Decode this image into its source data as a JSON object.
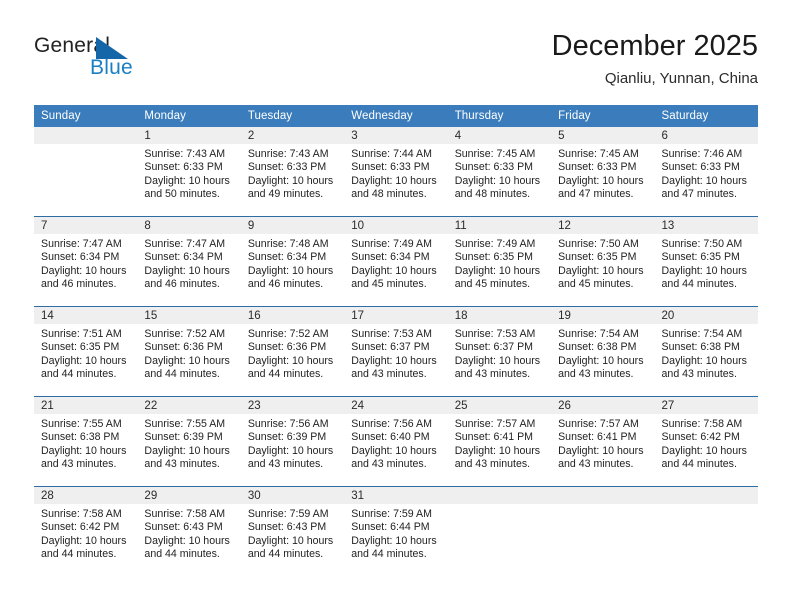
{
  "brand": {
    "name_primary": "General",
    "name_secondary": "Blue",
    "triangle_color": "#1566a8",
    "secondary_color": "#1b7fc4"
  },
  "header": {
    "title": "December 2025",
    "location": "Qianliu, Yunnan, China"
  },
  "theme": {
    "header_bg": "#3b7dbc",
    "header_text": "#ffffff",
    "date_band_bg": "#efefef",
    "row_rule": "#2e6da4",
    "body_text": "#1f1f1f"
  },
  "weekday_headers": [
    "Sunday",
    "Monday",
    "Tuesday",
    "Wednesday",
    "Thursday",
    "Friday",
    "Saturday"
  ],
  "labels": {
    "sunrise_prefix": "Sunrise:",
    "sunset_prefix": "Sunset:",
    "daylight_prefix": "Daylight:"
  },
  "weeks": [
    [
      {
        "day": "",
        "empty": true
      },
      {
        "day": "1",
        "sunrise": "Sunrise: 7:43 AM",
        "sunset": "Sunset: 6:33 PM",
        "daylight_line1": "Daylight: 10 hours",
        "daylight_line2": "and 50 minutes."
      },
      {
        "day": "2",
        "sunrise": "Sunrise: 7:43 AM",
        "sunset": "Sunset: 6:33 PM",
        "daylight_line1": "Daylight: 10 hours",
        "daylight_line2": "and 49 minutes."
      },
      {
        "day": "3",
        "sunrise": "Sunrise: 7:44 AM",
        "sunset": "Sunset: 6:33 PM",
        "daylight_line1": "Daylight: 10 hours",
        "daylight_line2": "and 48 minutes."
      },
      {
        "day": "4",
        "sunrise": "Sunrise: 7:45 AM",
        "sunset": "Sunset: 6:33 PM",
        "daylight_line1": "Daylight: 10 hours",
        "daylight_line2": "and 48 minutes."
      },
      {
        "day": "5",
        "sunrise": "Sunrise: 7:45 AM",
        "sunset": "Sunset: 6:33 PM",
        "daylight_line1": "Daylight: 10 hours",
        "daylight_line2": "and 47 minutes."
      },
      {
        "day": "6",
        "sunrise": "Sunrise: 7:46 AM",
        "sunset": "Sunset: 6:33 PM",
        "daylight_line1": "Daylight: 10 hours",
        "daylight_line2": "and 47 minutes."
      }
    ],
    [
      {
        "day": "7",
        "sunrise": "Sunrise: 7:47 AM",
        "sunset": "Sunset: 6:34 PM",
        "daylight_line1": "Daylight: 10 hours",
        "daylight_line2": "and 46 minutes."
      },
      {
        "day": "8",
        "sunrise": "Sunrise: 7:47 AM",
        "sunset": "Sunset: 6:34 PM",
        "daylight_line1": "Daylight: 10 hours",
        "daylight_line2": "and 46 minutes."
      },
      {
        "day": "9",
        "sunrise": "Sunrise: 7:48 AM",
        "sunset": "Sunset: 6:34 PM",
        "daylight_line1": "Daylight: 10 hours",
        "daylight_line2": "and 46 minutes."
      },
      {
        "day": "10",
        "sunrise": "Sunrise: 7:49 AM",
        "sunset": "Sunset: 6:34 PM",
        "daylight_line1": "Daylight: 10 hours",
        "daylight_line2": "and 45 minutes."
      },
      {
        "day": "11",
        "sunrise": "Sunrise: 7:49 AM",
        "sunset": "Sunset: 6:35 PM",
        "daylight_line1": "Daylight: 10 hours",
        "daylight_line2": "and 45 minutes."
      },
      {
        "day": "12",
        "sunrise": "Sunrise: 7:50 AM",
        "sunset": "Sunset: 6:35 PM",
        "daylight_line1": "Daylight: 10 hours",
        "daylight_line2": "and 45 minutes."
      },
      {
        "day": "13",
        "sunrise": "Sunrise: 7:50 AM",
        "sunset": "Sunset: 6:35 PM",
        "daylight_line1": "Daylight: 10 hours",
        "daylight_line2": "and 44 minutes."
      }
    ],
    [
      {
        "day": "14",
        "sunrise": "Sunrise: 7:51 AM",
        "sunset": "Sunset: 6:35 PM",
        "daylight_line1": "Daylight: 10 hours",
        "daylight_line2": "and 44 minutes."
      },
      {
        "day": "15",
        "sunrise": "Sunrise: 7:52 AM",
        "sunset": "Sunset: 6:36 PM",
        "daylight_line1": "Daylight: 10 hours",
        "daylight_line2": "and 44 minutes."
      },
      {
        "day": "16",
        "sunrise": "Sunrise: 7:52 AM",
        "sunset": "Sunset: 6:36 PM",
        "daylight_line1": "Daylight: 10 hours",
        "daylight_line2": "and 44 minutes."
      },
      {
        "day": "17",
        "sunrise": "Sunrise: 7:53 AM",
        "sunset": "Sunset: 6:37 PM",
        "daylight_line1": "Daylight: 10 hours",
        "daylight_line2": "and 43 minutes."
      },
      {
        "day": "18",
        "sunrise": "Sunrise: 7:53 AM",
        "sunset": "Sunset: 6:37 PM",
        "daylight_line1": "Daylight: 10 hours",
        "daylight_line2": "and 43 minutes."
      },
      {
        "day": "19",
        "sunrise": "Sunrise: 7:54 AM",
        "sunset": "Sunset: 6:38 PM",
        "daylight_line1": "Daylight: 10 hours",
        "daylight_line2": "and 43 minutes."
      },
      {
        "day": "20",
        "sunrise": "Sunrise: 7:54 AM",
        "sunset": "Sunset: 6:38 PM",
        "daylight_line1": "Daylight: 10 hours",
        "daylight_line2": "and 43 minutes."
      }
    ],
    [
      {
        "day": "21",
        "sunrise": "Sunrise: 7:55 AM",
        "sunset": "Sunset: 6:38 PM",
        "daylight_line1": "Daylight: 10 hours",
        "daylight_line2": "and 43 minutes."
      },
      {
        "day": "22",
        "sunrise": "Sunrise: 7:55 AM",
        "sunset": "Sunset: 6:39 PM",
        "daylight_line1": "Daylight: 10 hours",
        "daylight_line2": "and 43 minutes."
      },
      {
        "day": "23",
        "sunrise": "Sunrise: 7:56 AM",
        "sunset": "Sunset: 6:39 PM",
        "daylight_line1": "Daylight: 10 hours",
        "daylight_line2": "and 43 minutes."
      },
      {
        "day": "24",
        "sunrise": "Sunrise: 7:56 AM",
        "sunset": "Sunset: 6:40 PM",
        "daylight_line1": "Daylight: 10 hours",
        "daylight_line2": "and 43 minutes."
      },
      {
        "day": "25",
        "sunrise": "Sunrise: 7:57 AM",
        "sunset": "Sunset: 6:41 PM",
        "daylight_line1": "Daylight: 10 hours",
        "daylight_line2": "and 43 minutes."
      },
      {
        "day": "26",
        "sunrise": "Sunrise: 7:57 AM",
        "sunset": "Sunset: 6:41 PM",
        "daylight_line1": "Daylight: 10 hours",
        "daylight_line2": "and 43 minutes."
      },
      {
        "day": "27",
        "sunrise": "Sunrise: 7:58 AM",
        "sunset": "Sunset: 6:42 PM",
        "daylight_line1": "Daylight: 10 hours",
        "daylight_line2": "and 44 minutes."
      }
    ],
    [
      {
        "day": "28",
        "sunrise": "Sunrise: 7:58 AM",
        "sunset": "Sunset: 6:42 PM",
        "daylight_line1": "Daylight: 10 hours",
        "daylight_line2": "and 44 minutes."
      },
      {
        "day": "29",
        "sunrise": "Sunrise: 7:58 AM",
        "sunset": "Sunset: 6:43 PM",
        "daylight_line1": "Daylight: 10 hours",
        "daylight_line2": "and 44 minutes."
      },
      {
        "day": "30",
        "sunrise": "Sunrise: 7:59 AM",
        "sunset": "Sunset: 6:43 PM",
        "daylight_line1": "Daylight: 10 hours",
        "daylight_line2": "and 44 minutes."
      },
      {
        "day": "31",
        "sunrise": "Sunrise: 7:59 AM",
        "sunset": "Sunset: 6:44 PM",
        "daylight_line1": "Daylight: 10 hours",
        "daylight_line2": "and 44 minutes."
      },
      {
        "day": "",
        "empty": true
      },
      {
        "day": "",
        "empty": true
      },
      {
        "day": "",
        "empty": true
      }
    ]
  ]
}
